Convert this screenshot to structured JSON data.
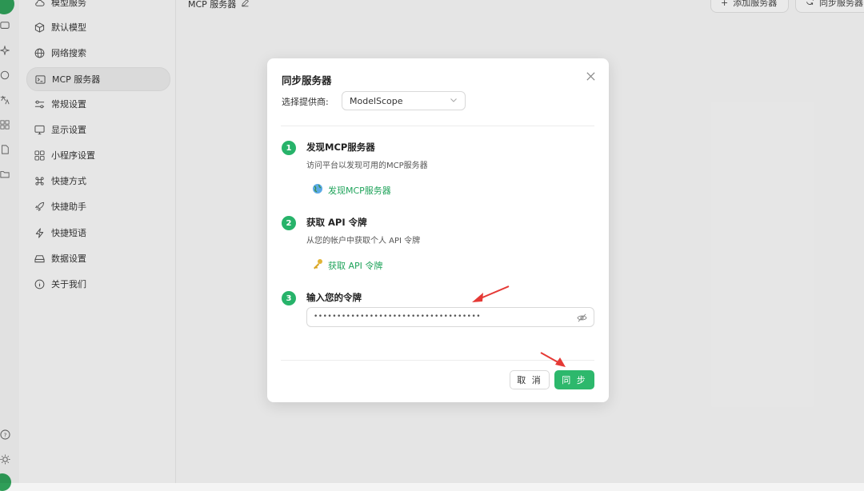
{
  "header": {
    "title": "MCP 服务器",
    "add_button": "添加服务器",
    "sync_button": "同步服务器"
  },
  "menu": {
    "items": [
      {
        "label": "模型服务",
        "icon": "cloud-icon"
      },
      {
        "label": "默认模型",
        "icon": "cube-icon"
      },
      {
        "label": "网络搜索",
        "icon": "globe-icon"
      },
      {
        "label": "MCP 服务器",
        "icon": "terminal-icon",
        "active": true
      },
      {
        "label": "常规设置",
        "icon": "sliders-icon"
      },
      {
        "label": "显示设置",
        "icon": "monitor-icon"
      },
      {
        "label": "小程序设置",
        "icon": "grid-icon"
      },
      {
        "label": "快捷方式",
        "icon": "command-icon"
      },
      {
        "label": "快捷助手",
        "icon": "rocket-icon"
      },
      {
        "label": "快捷短语",
        "icon": "zap-icon"
      },
      {
        "label": "数据设置",
        "icon": "drive-icon"
      },
      {
        "label": "关于我们",
        "icon": "info-icon"
      }
    ]
  },
  "dialog": {
    "title": "同步服务器",
    "provider_label": "选择提供商:",
    "provider_value": "ModelScope",
    "steps": [
      {
        "num": "1",
        "title": "发现MCP服务器",
        "desc": "访问平台以发现可用的MCP服务器",
        "link": "发现MCP服务器",
        "link_icon": "globe-emoji-icon"
      },
      {
        "num": "2",
        "title": "获取 API 令牌",
        "desc": "从您的帐户中获取个人 API 令牌",
        "link": "获取 API 令牌",
        "link_icon": "key-icon"
      },
      {
        "num": "3",
        "title": "输入您的令牌"
      }
    ],
    "token_value": "••••••••••••••••••••••••••••••••••••",
    "cancel_label": "取 消",
    "sync_label": "同 步"
  },
  "colors": {
    "accent": "#27b36a",
    "annotation_arrow": "#e53935"
  }
}
